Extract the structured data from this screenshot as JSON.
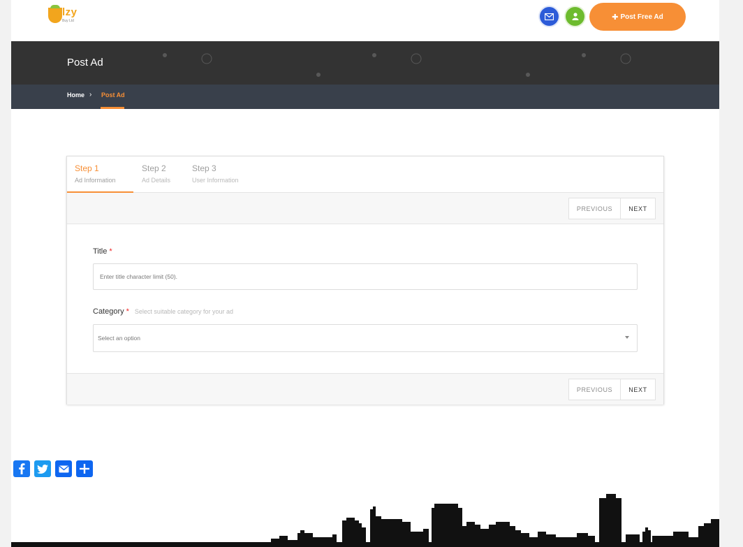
{
  "header": {
    "logo_word": "lzy",
    "logo_sub": "Buy Ltd",
    "post_button": "Post Free Ad"
  },
  "banner": {
    "title": "Post Ad"
  },
  "breadcrumb": {
    "home": "Home",
    "separator": "›",
    "current": "Post Ad"
  },
  "wizard": {
    "steps": [
      {
        "title": "Step 1",
        "subtitle": "Ad Information",
        "active": true
      },
      {
        "title": "Step 2",
        "subtitle": "Ad Details",
        "active": false
      },
      {
        "title": "Step 3",
        "subtitle": "User Information",
        "active": false
      }
    ],
    "previous_label": "PREVIOUS",
    "next_label": "NEXT"
  },
  "form": {
    "title_label": "Title",
    "title_required": "*",
    "title_placeholder": "Enter title  character limit (50).",
    "category_label": "Category",
    "category_required": "*",
    "category_hint": "Select suitable category for your ad",
    "category_selected": "Select an option"
  },
  "colors": {
    "accent": "#f78f36",
    "banner": "#333333",
    "breadcrumb_bar": "#39404b",
    "mail_icon_bg": "#2c5bd8",
    "user_icon_bg": "#6dbb2e"
  },
  "social_icons": [
    "facebook-icon",
    "twitter-icon",
    "email-icon",
    "share-icon"
  ]
}
